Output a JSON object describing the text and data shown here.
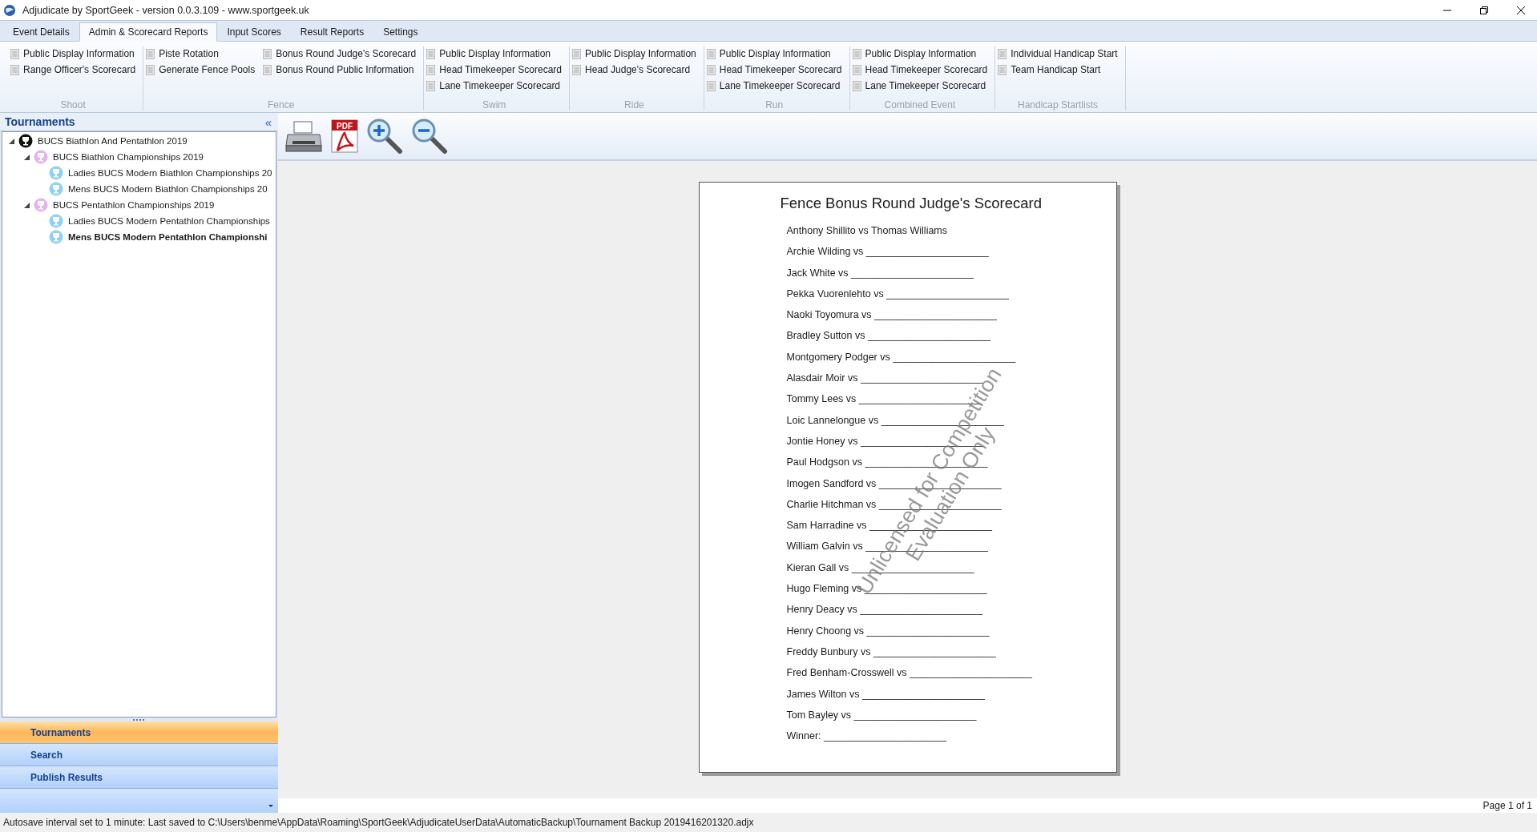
{
  "window": {
    "title": "Adjudicate by SportGeek -  version 0.0.3.109 - www.sportgeek.uk"
  },
  "tabs": [
    {
      "label": "Event Details",
      "selected": false
    },
    {
      "label": "Admin & Scorecard Reports",
      "selected": true
    },
    {
      "label": "Input Scores",
      "selected": false
    },
    {
      "label": "Result Reports",
      "selected": false
    },
    {
      "label": "Settings",
      "selected": false
    }
  ],
  "ribbon_groups": [
    {
      "label": "Shoot",
      "columns": [
        [
          "Public Display Information",
          "Range Officer's Scorecard"
        ]
      ]
    },
    {
      "label": "Fence",
      "columns": [
        [
          "Piste Rotation",
          "Generate Fence Pools"
        ],
        [
          "Bonus Round Judge's Scorecard",
          "Bonus Round Public Information"
        ]
      ]
    },
    {
      "label": "Swim",
      "columns": [
        [
          "Public Display Information",
          "Head Timekeeper Scorecard",
          "Lane Timekeeper Scorecard"
        ]
      ]
    },
    {
      "label": "Ride",
      "columns": [
        [
          "Public Display Information",
          "Head Judge's Scorecard"
        ]
      ]
    },
    {
      "label": "Run",
      "columns": [
        [
          "Public Display Information",
          "Head Timekeeper Scorecard",
          "Lane Timekeeper Scorecard"
        ]
      ]
    },
    {
      "label": "Combined Event",
      "columns": [
        [
          "Public Display Information",
          "Head Timekeeper Scorecard",
          "Lane Timekeeper Scorecard"
        ]
      ]
    },
    {
      "label": "Handicap Startlists",
      "columns": [
        [
          "Individual Handicap Start",
          "Team Handicap Start"
        ]
      ]
    }
  ],
  "sidebar": {
    "title": "Tournaments",
    "collapse_glyph": "«",
    "tree": [
      {
        "label": "BUCS Biathlon And Pentathlon 2019",
        "kind": "event",
        "expanded": true,
        "selected": false,
        "children": [
          {
            "label": "BUCS Biathlon Championships 2019",
            "kind": "championship",
            "expanded": true,
            "selected": false,
            "children": [
              {
                "label": "Ladies BUCS Modern Biathlon Championships 20",
                "kind": "competition",
                "selected": false
              },
              {
                "label": "Mens BUCS Modern Biathlon Championships 20",
                "kind": "competition",
                "selected": false
              }
            ]
          },
          {
            "label": "BUCS Pentathlon Championships 2019",
            "kind": "championship",
            "expanded": true,
            "selected": false,
            "children": [
              {
                "label": "Ladies BUCS Modern Pentathlon Championships",
                "kind": "competition",
                "selected": false
              },
              {
                "label": "Mens BUCS Modern Pentathlon Championshi",
                "kind": "competition",
                "selected": true
              }
            ]
          }
        ]
      }
    ],
    "nav": [
      {
        "label": "Tournaments",
        "selected": true
      },
      {
        "label": "Search",
        "selected": false
      },
      {
        "label": "Publish Results",
        "selected": false
      }
    ]
  },
  "toolbar": [
    {
      "kind": "print"
    },
    {
      "kind": "pdf",
      "label": "PDF"
    },
    {
      "kind": "zoom-in"
    },
    {
      "kind": "zoom-out"
    }
  ],
  "document": {
    "title": "Fence Bonus Round Judge's Scorecard",
    "lines": [
      "Anthony Shillito vs Thomas Williams",
      "Archie Wilding vs ______________________",
      "Jack White vs ______________________",
      "Pekka Vuorenlehto vs ______________________",
      "Naoki Toyomura vs ______________________",
      "Bradley Sutton vs ______________________",
      "Montgomery Podger vs ______________________",
      "Alasdair Moir vs ______________________",
      "Tommy Lees vs ______________________",
      "Loic Lannelongue vs ______________________",
      "Jontie Honey vs ______________________",
      "Paul Hodgson vs ______________________",
      "Imogen Sandford vs ______________________",
      "Charlie Hitchman vs ______________________",
      "Sam Harradine vs ______________________",
      "William Galvin vs ______________________",
      "Kieran Gall vs ______________________",
      "Hugo Fleming vs ______________________",
      "Henry Deacy vs ______________________",
      "Henry Choong vs ______________________",
      "Freddy Bunbury vs ______________________",
      "Fred Benham-Crosswell vs ______________________",
      "James Wilton vs ______________________",
      "Tom Bayley vs ______________________",
      "Winner: ______________________"
    ],
    "watermark": [
      "Unlicensed for Competition",
      "Evaluation Only"
    ]
  },
  "page_indicator": "Page 1 of 1",
  "status_bar": "Autosave interval set to 1 minute: Last saved to C:\\Users\\benme\\AppData\\Roaming\\SportGeek\\AdjudicateUserData\\AutomaticBackup\\Tournament Backup 2019416201320.adjx"
}
